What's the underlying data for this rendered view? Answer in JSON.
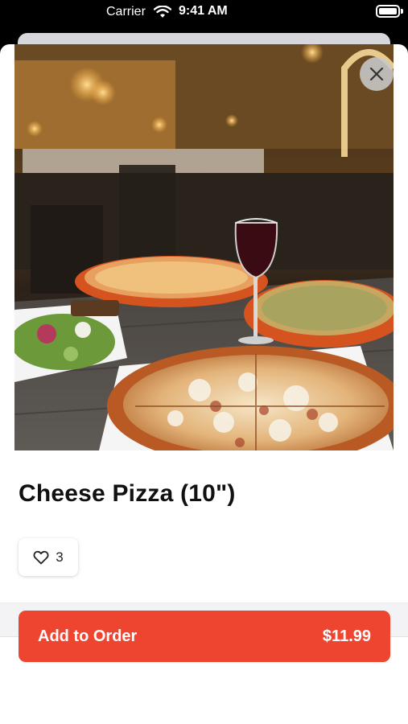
{
  "status_bar": {
    "carrier": "Carrier",
    "time": "9:41 AM"
  },
  "item": {
    "title": "Cheese Pizza (10\")",
    "like_count": "3",
    "image_icon": "pizza-photo"
  },
  "actions": {
    "close_icon": "close-icon",
    "add_label": "Add to Order",
    "add_price": "$11.99"
  },
  "colors": {
    "accent": "#ee4530",
    "background": "#ffffff",
    "muted_band": "#f3f3f5"
  }
}
